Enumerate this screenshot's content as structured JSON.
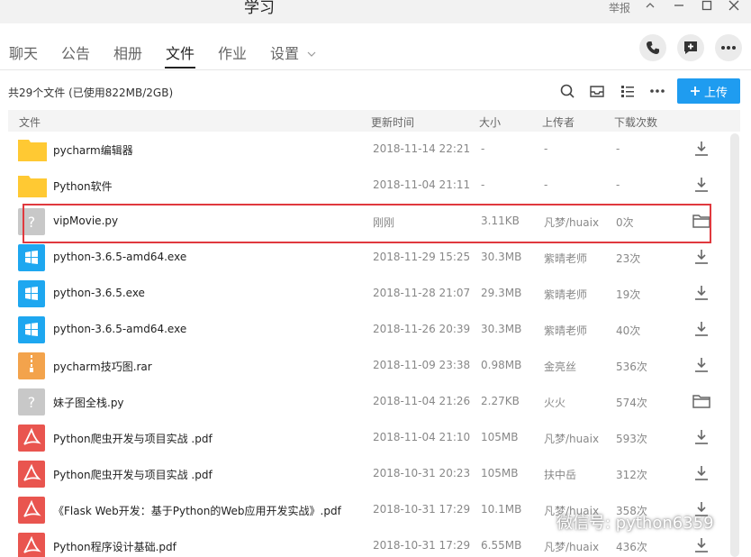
{
  "window": {
    "title": "学习",
    "report": "举报"
  },
  "tabs": [
    {
      "label": "聊天"
    },
    {
      "label": "公告"
    },
    {
      "label": "相册"
    },
    {
      "label": "文件",
      "active": true
    },
    {
      "label": "作业"
    },
    {
      "label": "设置"
    }
  ],
  "toolbar": {
    "summary": "共29个文件 (已使用822MB/2GB)",
    "upload_label": "上传"
  },
  "columns": {
    "name": "文件",
    "time": "更新时间",
    "size": "大小",
    "uploader": "上传者",
    "count": "下载次数"
  },
  "colors": {
    "accent": "#1f9cf0",
    "highlight": "#e0393e",
    "folder": "#ffc933",
    "exe": "#1ea7f0",
    "rar": "#f3a34c",
    "pdf": "#e9554f",
    "unknown": "#c8c8c8"
  },
  "files": [
    {
      "type": "folder",
      "name": "pycharm编辑器",
      "time": "2018-11-14 22:21",
      "size": "-",
      "uploader": "-",
      "count": "-",
      "action": "download-icon"
    },
    {
      "type": "folder",
      "name": "Python软件",
      "time": "2018-11-04 21:11",
      "size": "-",
      "uploader": "-",
      "count": "-",
      "action": "download-icon"
    },
    {
      "type": "unknown",
      "name": "vipMovie.py",
      "time": "刚刚",
      "size": "3.11KB",
      "uploader": "凡梦/huaix",
      "count": "0次",
      "action": "folder-open-icon"
    },
    {
      "type": "exe",
      "name": "python-3.6.5-amd64.exe",
      "time": "2018-11-29 15:25",
      "size": "30.3MB",
      "uploader": "紫晴老师",
      "count": "23次",
      "action": "download-icon"
    },
    {
      "type": "exe",
      "name": "python-3.6.5.exe",
      "time": "2018-11-28 21:07",
      "size": "29.3MB",
      "uploader": "紫晴老师",
      "count": "19次",
      "action": "download-icon"
    },
    {
      "type": "exe",
      "name": "python-3.6.5-amd64.exe",
      "time": "2018-11-26 20:39",
      "size": "30.3MB",
      "uploader": "紫晴老师",
      "count": "40次",
      "action": "download-icon"
    },
    {
      "type": "rar",
      "name": "pycharm技巧图.rar",
      "time": "2018-11-09 23:38",
      "size": "0.98MB",
      "uploader": "金亮丝",
      "count": "536次",
      "action": "download-icon"
    },
    {
      "type": "unknown",
      "name": "妹子图全栈.py",
      "time": "2018-11-04 21:26",
      "size": "2.27KB",
      "uploader": "火火",
      "count": "574次",
      "action": "folder-open-icon"
    },
    {
      "type": "pdf",
      "name": "Python爬虫开发与项目实战 .pdf",
      "time": "2018-11-04 21:10",
      "size": "105MB",
      "uploader": "凡梦/huaix",
      "count": "593次",
      "action": "download-icon"
    },
    {
      "type": "pdf",
      "name": "Python爬虫开发与项目实战 .pdf",
      "time": "2018-10-31 20:23",
      "size": "105MB",
      "uploader": "扶中岳",
      "count": "312次",
      "action": "download-icon"
    },
    {
      "type": "pdf",
      "name": "《Flask Web开发：基于Python的Web应用开发实战》.pdf",
      "time": "2018-10-31 17:29",
      "size": "10.1MB",
      "uploader": "凡梦/huaix",
      "count": "358次",
      "action": "download-icon"
    },
    {
      "type": "pdf",
      "name": "Python程序设计基础.pdf",
      "time": "2018-10-31 17:29",
      "size": "6.55MB",
      "uploader": "凡梦/huaix",
      "count": "436次",
      "action": "download-icon"
    }
  ],
  "watermark": "微信号: python6359"
}
